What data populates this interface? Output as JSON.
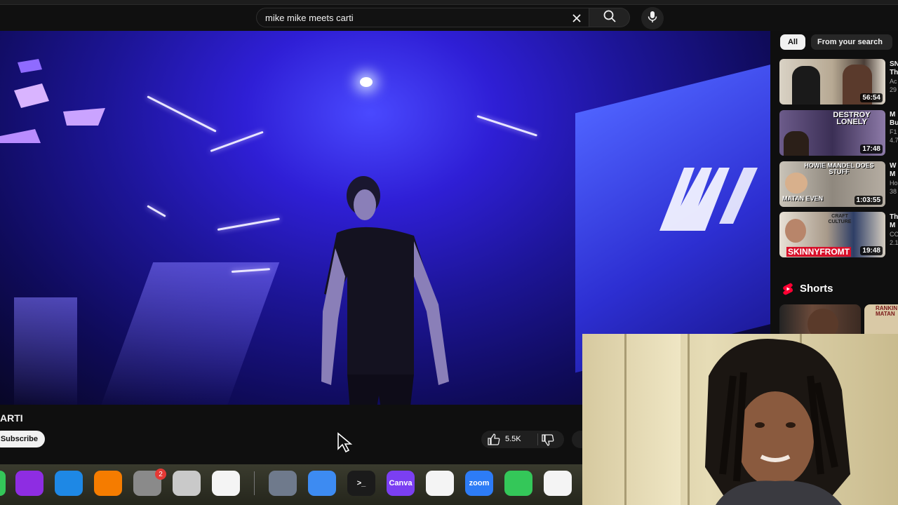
{
  "search": {
    "query": "mike mike meets carti"
  },
  "video": {
    "title_fragment": "ARTI",
    "subscribe_label": "Subscribe",
    "like_count": "5.5K"
  },
  "sidebar": {
    "chips": [
      "All",
      "From your search"
    ],
    "recommendations": [
      {
        "thumb_text": "",
        "duration": "56:54",
        "title_fragment": "SN",
        "title_fragment2": "Th",
        "channel_fragment": "Ac",
        "views_fragment": "29"
      },
      {
        "thumb_text": "DESTROY LONELY",
        "duration": "17:48",
        "title_fragment": "M",
        "title_fragment2": "Bu",
        "channel_fragment": "F1",
        "views_fragment": "4.7"
      },
      {
        "thumb_text": "HOWIE MANDEL DOES STUFF",
        "thumb_text2": "MATAN EVEN",
        "duration": "1:03:55",
        "title_fragment": "W",
        "title_fragment2": "M",
        "channel_fragment": "Ho",
        "views_fragment": "38"
      },
      {
        "thumb_text": "SKINNYFROMT",
        "thumb_text2": "CRAFT CULTURE",
        "duration": "19:48",
        "title_fragment": "Th",
        "title_fragment2": "M",
        "channel_fragment": "CO",
        "views_fragment": "2.1"
      }
    ],
    "shorts_label": "Shorts",
    "shorts_thumb_text": "RANKIN MATAN"
  },
  "dock": {
    "badge_count": "2",
    "apps": [
      {
        "name": "podcasts",
        "label": "",
        "color": "#8e2de2"
      },
      {
        "name": "keynote",
        "label": "",
        "color": "#1e88e5"
      },
      {
        "name": "pages",
        "label": "",
        "color": "#f57c00"
      },
      {
        "name": "system-settings",
        "label": "",
        "color": "#8a8a8a"
      },
      {
        "name": "iphone-mirroring",
        "label": "",
        "color": "#c9c9c9"
      },
      {
        "name": "freeform",
        "label": "",
        "color": "#f4f4f4"
      },
      {
        "name": "preview",
        "label": "",
        "color": "#6f7a8c"
      },
      {
        "name": "bluetooth",
        "label": "",
        "color": "#3d8bf2"
      },
      {
        "name": "terminal",
        "label": ">_",
        "color": "#1b1b1b"
      },
      {
        "name": "canva",
        "label": "Canva",
        "color": "#7b3ff2"
      },
      {
        "name": "vscode",
        "label": "",
        "color": "#f4f4f4"
      },
      {
        "name": "zoom",
        "label": "zoom",
        "color": "#2d7cf6"
      },
      {
        "name": "messages",
        "label": "",
        "color": "#34c759"
      },
      {
        "name": "photos",
        "label": "",
        "color": "#f4f4f4"
      }
    ]
  },
  "colors": {
    "youtube_red": "#ff0033",
    "stage_blue": "#2f1fd6"
  }
}
